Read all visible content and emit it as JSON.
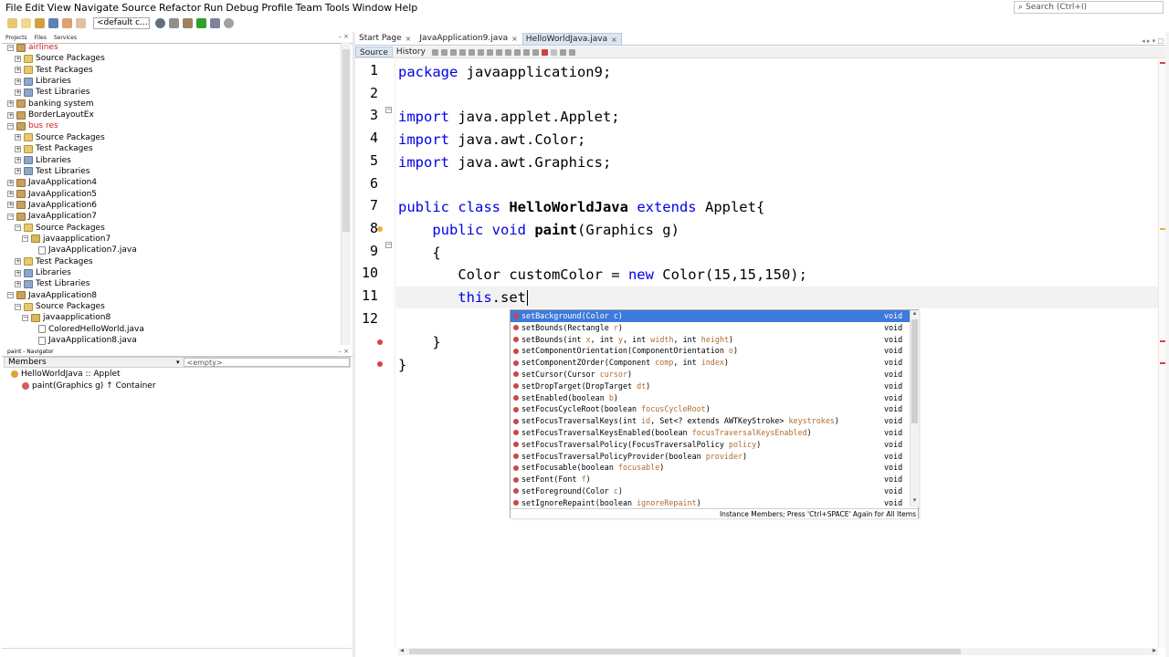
{
  "menu": [
    "File",
    "Edit",
    "View",
    "Navigate",
    "Source",
    "Refactor",
    "Run",
    "Debug",
    "Profile",
    "Team",
    "Tools",
    "Window",
    "Help"
  ],
  "search": {
    "placeholder": "Search (Ctrl+I)"
  },
  "toolbar": {
    "config": "<default c...>"
  },
  "left_tabs": [
    "Projects",
    "Files",
    "Services"
  ],
  "project_tree": [
    {
      "label": "airlines",
      "level": 0,
      "icon": "project",
      "expander": "⊟",
      "red": true
    },
    {
      "label": "Source Packages",
      "level": 1,
      "icon": "folder",
      "expander": "⊞"
    },
    {
      "label": "Test Packages",
      "level": 1,
      "icon": "folder",
      "expander": "⊞"
    },
    {
      "label": "Libraries",
      "level": 1,
      "icon": "lib",
      "expander": "⊞"
    },
    {
      "label": "Test Libraries",
      "level": 1,
      "icon": "lib",
      "expander": "⊞"
    },
    {
      "label": "banking system",
      "level": 0,
      "icon": "project",
      "expander": "⊞"
    },
    {
      "label": "BorderLayoutEx",
      "level": 0,
      "icon": "project",
      "expander": "⊞"
    },
    {
      "label": "bus res",
      "level": 0,
      "icon": "project",
      "expander": "⊟",
      "red": true
    },
    {
      "label": "Source Packages",
      "level": 1,
      "icon": "folder",
      "expander": "⊞"
    },
    {
      "label": "Test Packages",
      "level": 1,
      "icon": "folder",
      "expander": "⊞"
    },
    {
      "label": "Libraries",
      "level": 1,
      "icon": "lib",
      "expander": "⊞"
    },
    {
      "label": "Test Libraries",
      "level": 1,
      "icon": "lib",
      "expander": "⊞"
    },
    {
      "label": "JavaApplication4",
      "level": 0,
      "icon": "project",
      "expander": "⊞"
    },
    {
      "label": "JavaApplication5",
      "level": 0,
      "icon": "project",
      "expander": "⊞"
    },
    {
      "label": "JavaApplication6",
      "level": 0,
      "icon": "project",
      "expander": "⊞"
    },
    {
      "label": "JavaApplication7",
      "level": 0,
      "icon": "project",
      "expander": "⊟"
    },
    {
      "label": "Source Packages",
      "level": 1,
      "icon": "folder",
      "expander": "⊟"
    },
    {
      "label": "javaapplication7",
      "level": 2,
      "icon": "package",
      "expander": "⊟"
    },
    {
      "label": "JavaApplication7.java",
      "level": 3,
      "icon": "java",
      "expander": ""
    },
    {
      "label": "Test Packages",
      "level": 1,
      "icon": "folder",
      "expander": "⊞"
    },
    {
      "label": "Libraries",
      "level": 1,
      "icon": "lib",
      "expander": "⊞"
    },
    {
      "label": "Test Libraries",
      "level": 1,
      "icon": "lib",
      "expander": "⊞"
    },
    {
      "label": "JavaApplication8",
      "level": 0,
      "icon": "project",
      "expander": "⊟"
    },
    {
      "label": "Source Packages",
      "level": 1,
      "icon": "folder",
      "expander": "⊟"
    },
    {
      "label": "javaapplication8",
      "level": 2,
      "icon": "package",
      "expander": "⊟"
    },
    {
      "label": "ColoredHelloWorld.java",
      "level": 3,
      "icon": "java",
      "expander": ""
    },
    {
      "label": "JavaApplication8.java",
      "level": 3,
      "icon": "java",
      "expander": ""
    }
  ],
  "navigator": {
    "tab": "paint - Navigator",
    "members_label": "Members",
    "filter": "<empty>",
    "rows": [
      "HelloWorldJava :: Applet",
      "paint(Graphics g) ↑ Container"
    ]
  },
  "editor_tabs": [
    {
      "label": "Start Page",
      "active": false
    },
    {
      "label": "JavaApplication9.java",
      "active": false
    },
    {
      "label": "HelloWorldJava.java",
      "active": true
    }
  ],
  "editor_toolbar": {
    "source": "Source",
    "history": "History"
  },
  "code": {
    "line_numbers": [
      "1",
      "2",
      "3",
      "4",
      "5",
      "6",
      "7",
      "8",
      "9",
      "10",
      "11",
      "12"
    ],
    "lines": [
      [
        [
          "kw",
          "package "
        ],
        [
          "plain",
          "javaapplication9;"
        ]
      ],
      [],
      [
        [
          "kw",
          "import "
        ],
        [
          "plain",
          "java.applet.Applet;"
        ]
      ],
      [
        [
          "kw",
          "import "
        ],
        [
          "plain",
          "java.awt.Color;"
        ]
      ],
      [
        [
          "kw",
          "import "
        ],
        [
          "plain",
          "java.awt.Graphics;"
        ]
      ],
      [],
      [
        [
          "kw",
          "public class "
        ],
        [
          "cls",
          "HelloWorldJava"
        ],
        [
          "kw",
          " extends "
        ],
        [
          "plain",
          "Applet{"
        ]
      ],
      [
        [
          "plain",
          "    "
        ],
        [
          "kw",
          "public void "
        ],
        [
          "cls",
          "paint"
        ],
        [
          "plain",
          "(Graphics g)"
        ]
      ],
      [
        [
          "plain",
          "    {"
        ]
      ],
      [
        [
          "plain",
          "       Color customColor = "
        ],
        [
          "kw",
          "new "
        ],
        [
          "plain",
          "Color(15,15,150);"
        ]
      ],
      [
        [
          "plain",
          "       "
        ],
        [
          "kw",
          "this"
        ],
        [
          "plain",
          ".set"
        ]
      ],
      [],
      [
        [
          "plain",
          "    }"
        ]
      ],
      [
        [
          "plain",
          "}"
        ]
      ]
    ]
  },
  "completion": {
    "items": [
      {
        "name": "setBackground",
        "params": [
          [
            "Color",
            "c"
          ]
        ],
        "rtype": "void",
        "selected": true
      },
      {
        "name": "setBounds",
        "params": [
          [
            "Rectangle",
            "r"
          ]
        ],
        "rtype": "void"
      },
      {
        "name": "setBounds",
        "params": [
          [
            "int",
            "x"
          ],
          [
            "int",
            "y"
          ],
          [
            "int",
            "width"
          ],
          [
            "int",
            "height"
          ]
        ],
        "rtype": "void"
      },
      {
        "name": "setComponentOrientation",
        "params": [
          [
            "ComponentOrientation",
            "o"
          ]
        ],
        "rtype": "void"
      },
      {
        "name": "setComponentZOrder",
        "params": [
          [
            "Component",
            "comp"
          ],
          [
            "int",
            "index"
          ]
        ],
        "rtype": "void"
      },
      {
        "name": "setCursor",
        "params": [
          [
            "Cursor",
            "cursor"
          ]
        ],
        "rtype": "void"
      },
      {
        "name": "setDropTarget",
        "params": [
          [
            "DropTarget",
            "dt"
          ]
        ],
        "rtype": "void"
      },
      {
        "name": "setEnabled",
        "params": [
          [
            "boolean",
            "b"
          ]
        ],
        "rtype": "void"
      },
      {
        "name": "setFocusCycleRoot",
        "params": [
          [
            "boolean",
            "focusCycleRoot"
          ]
        ],
        "rtype": "void"
      },
      {
        "name": "setFocusTraversalKeys",
        "params": [
          [
            "int",
            "id"
          ],
          [
            "Set<? extends AWTKeyStroke>",
            "keystrokes"
          ]
        ],
        "rtype": "void"
      },
      {
        "name": "setFocusTraversalKeysEnabled",
        "params": [
          [
            "boolean",
            "focusTraversalKeysEnabled"
          ]
        ],
        "rtype": "void"
      },
      {
        "name": "setFocusTraversalPolicy",
        "params": [
          [
            "FocusTraversalPolicy",
            "policy"
          ]
        ],
        "rtype": "void"
      },
      {
        "name": "setFocusTraversalPolicyProvider",
        "params": [
          [
            "boolean",
            "provider"
          ]
        ],
        "rtype": "void"
      },
      {
        "name": "setFocusable",
        "params": [
          [
            "boolean",
            "focusable"
          ]
        ],
        "rtype": "void"
      },
      {
        "name": "setFont",
        "params": [
          [
            "Font",
            "f"
          ]
        ],
        "rtype": "void"
      },
      {
        "name": "setForeground",
        "params": [
          [
            "Color",
            "c"
          ]
        ],
        "rtype": "void"
      },
      {
        "name": "setIgnoreRepaint",
        "params": [
          [
            "boolean",
            "ignoreRepaint"
          ]
        ],
        "rtype": "void"
      }
    ],
    "footer": "Instance Members; Press 'Ctrl+SPACE' Again for All Items"
  },
  "colors": {
    "keyword": "#0000e6",
    "selection": "#3c7adb",
    "error": "#e04040"
  }
}
